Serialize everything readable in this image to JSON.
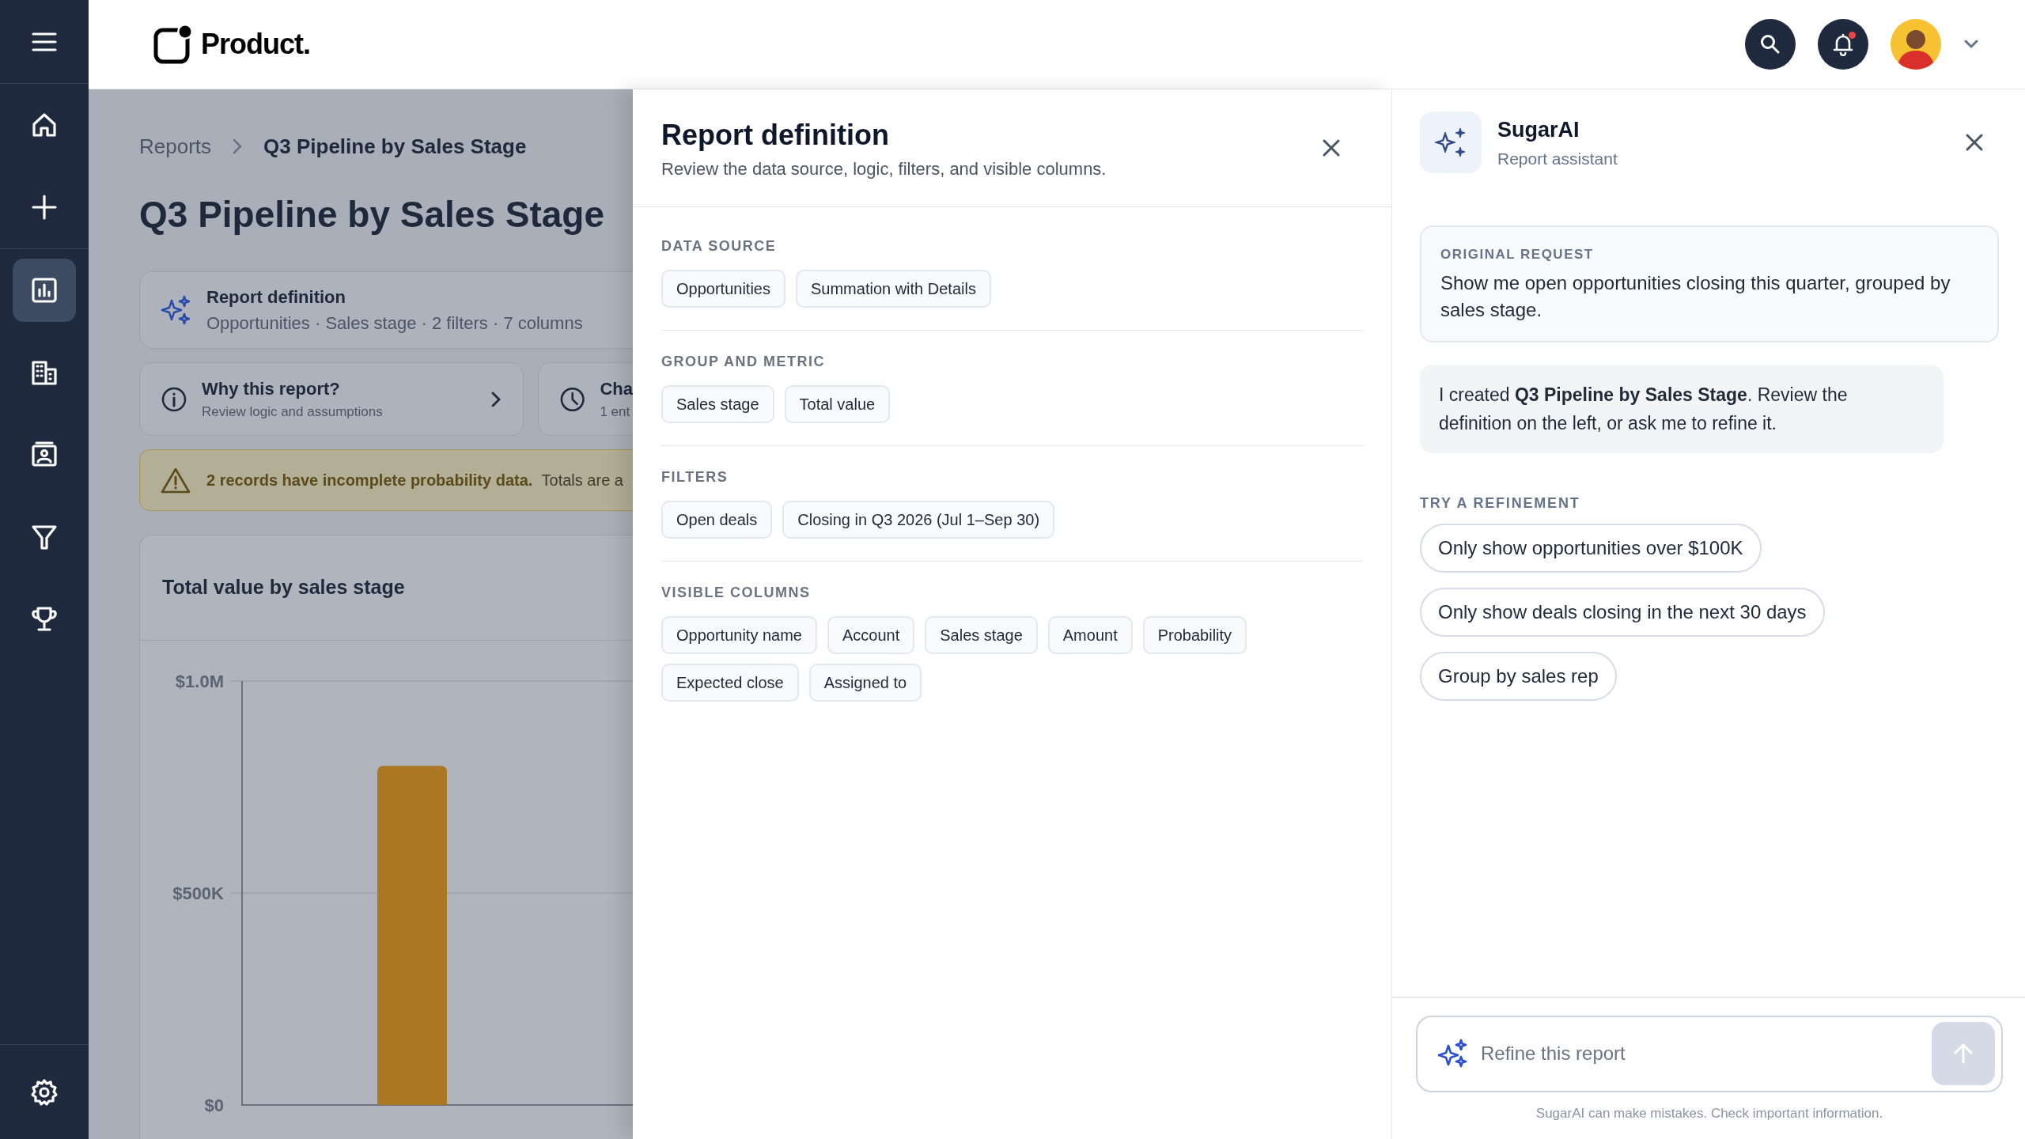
{
  "header": {
    "logo": "Product.",
    "notification_dot": true
  },
  "sidebar": {
    "items": [
      {
        "selected": false
      },
      {
        "selected": false
      },
      {
        "selected": false
      },
      {
        "selected": true
      },
      {
        "selected": false
      },
      {
        "selected": false
      },
      {
        "selected": false
      },
      {
        "selected": false
      },
      {
        "selected": false
      }
    ]
  },
  "report": {
    "breadcrumb": [
      "Reports",
      "Q3 Pipeline by Sales Stage"
    ],
    "title": "Q3 Pipeline by Sales Stage",
    "definition_card": {
      "title": "Report definition",
      "subtitle": "Opportunities · Sales stage · 2 filters · 7 columns"
    },
    "info_cards": [
      {
        "title": "Why this report?",
        "subtitle": "Review logic and assumptions"
      },
      {
        "title": "Cha",
        "subtitle": "1 ent"
      }
    ],
    "warning": "**2 records have incomplete probability data.** Totals are a",
    "chart_data": {
      "type": "bar",
      "title": "Total value by sales stage",
      "values": [
        800000
      ],
      "ylim": [
        0,
        1000000
      ],
      "yticks": [
        {
          "value": 0,
          "label": "$0"
        },
        {
          "value": 500000,
          "label": "$500K"
        },
        {
          "value": 1000000,
          "label": "$1.0M"
        }
      ]
    }
  },
  "definition_panel": {
    "title": "Report definition",
    "subtitle": "Review the data source, logic, filters, and visible columns.",
    "sections": [
      {
        "label": "DATA SOURCE",
        "chips": [
          "Opportunities",
          "Summation with Details"
        ]
      },
      {
        "label": "GROUP AND METRIC",
        "chips": [
          "Sales stage",
          "Total value"
        ]
      },
      {
        "label": "FILTERS",
        "chips": [
          "Open deals",
          "Closing in Q3 2026 (Jul 1–Sep 30)"
        ]
      },
      {
        "label": "VISIBLE COLUMNS",
        "chips": [
          "Opportunity name",
          "Account",
          "Sales stage",
          "Amount",
          "Probability",
          "Expected close",
          "Assigned to"
        ]
      }
    ]
  },
  "assistant": {
    "name": "SugarAI",
    "subtitle": "Report assistant",
    "original_request": {
      "label": "ORIGINAL REQUEST",
      "text": "Show me open opportunities closing this quarter, grouped by sales stage."
    },
    "message": "I created **Q3 Pipeline by Sales Stage**. Review the definition on the left, or ask me to refine it.",
    "refinement_label": "TRY A REFINEMENT",
    "refinements": [
      "Only show opportunities over $100K",
      "Only show deals closing in the next 30 days",
      "Group by sales rep"
    ],
    "input": {
      "placeholder": "Refine this report"
    },
    "disclaimer": "SugarAI can make mistakes. Check important information."
  }
}
